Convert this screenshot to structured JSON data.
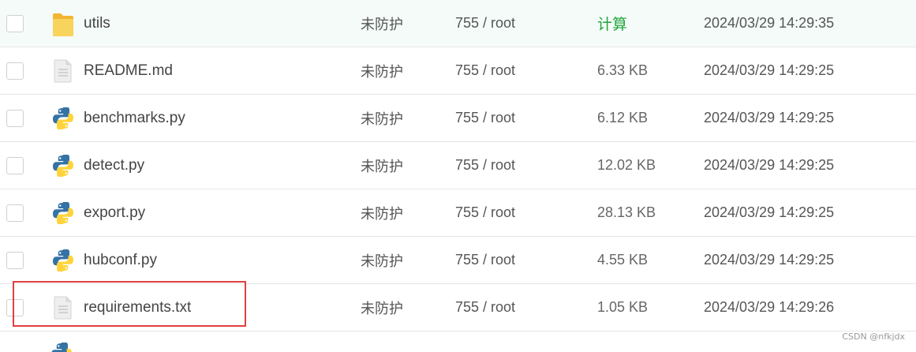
{
  "files": [
    {
      "name": "utils",
      "icon": "folder-icon",
      "protection": "未防护",
      "permission": "755 / root",
      "size": "计算",
      "size_is_action": true,
      "modified": "2024/03/29 14:29:35",
      "hover": true
    },
    {
      "name": "README.md",
      "icon": "text-file-icon",
      "protection": "未防护",
      "permission": "755 / root",
      "size": "6.33 KB",
      "size_is_action": false,
      "modified": "2024/03/29 14:29:25",
      "hover": false
    },
    {
      "name": "benchmarks.py",
      "icon": "python-file-icon",
      "protection": "未防护",
      "permission": "755 / root",
      "size": "6.12 KB",
      "size_is_action": false,
      "modified": "2024/03/29 14:29:25",
      "hover": false
    },
    {
      "name": "detect.py",
      "icon": "python-file-icon",
      "protection": "未防护",
      "permission": "755 / root",
      "size": "12.02 KB",
      "size_is_action": false,
      "modified": "2024/03/29 14:29:25",
      "hover": false
    },
    {
      "name": "export.py",
      "icon": "python-file-icon",
      "protection": "未防护",
      "permission": "755 / root",
      "size": "28.13 KB",
      "size_is_action": false,
      "modified": "2024/03/29 14:29:25",
      "hover": false
    },
    {
      "name": "hubconf.py",
      "icon": "python-file-icon",
      "protection": "未防护",
      "permission": "755 / root",
      "size": "4.55 KB",
      "size_is_action": false,
      "modified": "2024/03/29 14:29:25",
      "hover": false
    },
    {
      "name": "requirements.txt",
      "icon": "text-file-icon",
      "protection": "未防护",
      "permission": "755 / root",
      "size": "1.05 KB",
      "size_is_action": false,
      "modified": "2024/03/29 14:29:26",
      "hover": false
    }
  ],
  "next_row_icon": "python-file-icon",
  "watermark": "CSDN @nfkjdx",
  "colors": {
    "action_green": "#20a53a",
    "highlight_red": "#e0403f",
    "hover_row": "#f4fbf8",
    "folder_yellow": "#f7c948",
    "python_blue": "#3572a5",
    "python_yellow": "#ffd43b"
  }
}
